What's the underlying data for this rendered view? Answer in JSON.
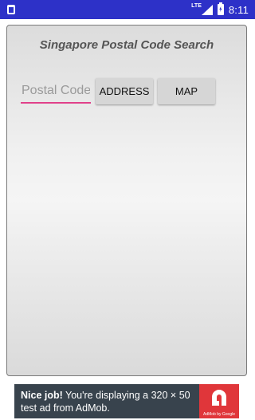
{
  "status_bar": {
    "network": "LTE",
    "time": "8:11",
    "icons": [
      "notification-icon",
      "signal-icon",
      "battery-icon"
    ],
    "background": "#2d31c8"
  },
  "app": {
    "title": "Singapore Postal Code Search",
    "postal_placeholder": "Postal Code",
    "postal_value": "",
    "address_button": "ADDRESS",
    "map_button": "MAP",
    "accent": "#e0408a"
  },
  "ad": {
    "bold_text": "Nice job!",
    "text": " You're displaying a 320 × 50 test ad from AdMob.",
    "logo_caption": "AdMob by Google",
    "logo_color": "#e0363a",
    "background": "#38434d"
  }
}
